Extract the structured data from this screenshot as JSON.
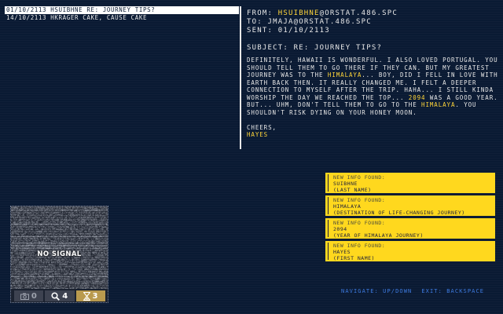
{
  "mail_list": [
    {
      "date": "01/10/2113",
      "from": "HSUIBHNE",
      "subject": "RE: JOURNEY TIPS?",
      "selected": true
    },
    {
      "date": "14/10/2113",
      "from": "HKRAGER",
      "subject": "CAKE, CAUSE CAKE",
      "selected": false
    }
  ],
  "mail": {
    "from_label": "FROM:",
    "from_highlight": "HSUIBHNE",
    "from_rest": "@ORSTAT.486.SPC",
    "to_label": "TO:",
    "to_value": "JMAJA@ORSTAT.486.SPC",
    "sent_label": "SENT:",
    "sent_value": "01/10/2113",
    "subject_label": "SUBJECT:",
    "subject_value": "RE: JOURNEY TIPS?",
    "body_1": "DEFINITELY, HAWAII IS WONDERFUL. I ALSO LOVED PORTUGAL. YOU SHOULD TELL THEM TO GO THERE IF THEY CAN. BUT MY GREATEST JOURNEY WAS TO THE ",
    "body_hl_1": "HIMALAYA",
    "body_2": "... BOY, DID I FELL IN LOVE WITH EARTH BACK THEN. IT REALLY CHANGED ME. I FELT A DEEPER CONNECTION TO MYSELF AFTER THE TRIP. HAHA... I STILL KINDA WORSHIP THE DAY WE REACHED THE TOP... ",
    "body_hl_2": "2094",
    "body_3": " WAS A GOOD YEAR. BUT... UHM, DON'T TELL THEM TO GO TO THE ",
    "body_hl_3": "HIMALAYA",
    "body_4": ". YOU SHOULDN'T RISK DYING ON YOUR HONEY MOON.",
    "closing": "CHEERS,",
    "signature": "HAYES"
  },
  "info_cards": [
    {
      "title": "NEW INFO FOUND:",
      "value": "SUIBHNE",
      "label": "(LAST NAME)"
    },
    {
      "title": "NEW INFO FOUND:",
      "value": "HIMALAYA",
      "label": "(DESTINATION OF LIFE-CHANGING JOURNEY)"
    },
    {
      "title": "NEW INFO FOUND:",
      "value": "2094",
      "label": "(YEAR OF HIMALAYA JOURNEY)"
    },
    {
      "title": "NEW INFO FOUND:",
      "value": "HAYES",
      "label": "(FIRST NAME)"
    }
  ],
  "nav": {
    "navigate": "NAVIGATE: UP/DOWN",
    "exit": "EXIT: BACKSPACE"
  },
  "monitor": {
    "no_signal": "NO SIGNAL",
    "stats": [
      {
        "icon": "camera-icon",
        "value": "0"
      },
      {
        "icon": "magnifier-icon",
        "value": "4"
      },
      {
        "icon": "hourglass-icon",
        "value": "3"
      }
    ]
  },
  "colors": {
    "highlight": "#ffd53a",
    "card": "#ffd81e",
    "background": "#0a1a33",
    "nav": "#3d7ae0"
  }
}
